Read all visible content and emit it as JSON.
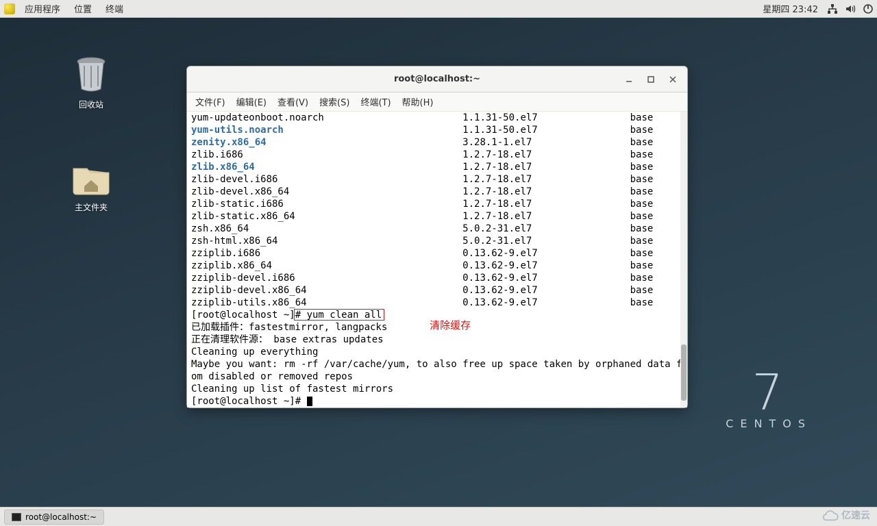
{
  "panel": {
    "apps": "应用程序",
    "places": "位置",
    "terminal": "终端",
    "clock": "星期四 23:42"
  },
  "desktop": {
    "trash_label": "回收站",
    "home_label": "主文件夹"
  },
  "brand": {
    "seven": "7",
    "centos": "CENTOS"
  },
  "taskbar": {
    "task1": "root@localhost:~"
  },
  "watermark": "亿速云",
  "window": {
    "title": "root@localhost:~",
    "menus": [
      "文件(F)",
      "编辑(E)",
      "查看(V)",
      "搜索(S)",
      "终端(T)",
      "帮助(H)"
    ]
  },
  "annotation": {
    "clear_cache": "清除缓存"
  },
  "packages": [
    {
      "name": "yum-updateonboot.noarch",
      "version": "1.1.31-50.el7",
      "repo": "base",
      "hl": false
    },
    {
      "name": "yum-utils.noarch",
      "version": "1.1.31-50.el7",
      "repo": "base",
      "hl": true
    },
    {
      "name": "zenity.x86_64",
      "version": "3.28.1-1.el7",
      "repo": "base",
      "hl": true
    },
    {
      "name": "zlib.i686",
      "version": "1.2.7-18.el7",
      "repo": "base",
      "hl": false
    },
    {
      "name": "zlib.x86_64",
      "version": "1.2.7-18.el7",
      "repo": "base",
      "hl": true
    },
    {
      "name": "zlib-devel.i686",
      "version": "1.2.7-18.el7",
      "repo": "base",
      "hl": false
    },
    {
      "name": "zlib-devel.x86_64",
      "version": "1.2.7-18.el7",
      "repo": "base",
      "hl": false
    },
    {
      "name": "zlib-static.i686",
      "version": "1.2.7-18.el7",
      "repo": "base",
      "hl": false
    },
    {
      "name": "zlib-static.x86_64",
      "version": "1.2.7-18.el7",
      "repo": "base",
      "hl": false
    },
    {
      "name": "zsh.x86_64",
      "version": "5.0.2-31.el7",
      "repo": "base",
      "hl": false
    },
    {
      "name": "zsh-html.x86_64",
      "version": "5.0.2-31.el7",
      "repo": "base",
      "hl": false
    },
    {
      "name": "zziplib.i686",
      "version": "0.13.62-9.el7",
      "repo": "base",
      "hl": false
    },
    {
      "name": "zziplib.x86_64",
      "version": "0.13.62-9.el7",
      "repo": "base",
      "hl": false
    },
    {
      "name": "zziplib-devel.i686",
      "version": "0.13.62-9.el7",
      "repo": "base",
      "hl": false
    },
    {
      "name": "zziplib-devel.x86_64",
      "version": "0.13.62-9.el7",
      "repo": "base",
      "hl": false
    },
    {
      "name": "zziplib-utils.x86_64",
      "version": "0.13.62-9.el7",
      "repo": "base",
      "hl": false
    }
  ],
  "terminal_lines": {
    "prompt1_pre": "[root@localhost ~]",
    "prompt1_cmd": "# yum clean all",
    "l1": "已加载插件：fastestmirror, langpacks",
    "l2": "正在清理软件源： base extras updates",
    "l3": "Cleaning up everything",
    "l4": "Maybe you want: rm -rf /var/cache/yum, to also free up space taken by orphaned data from disabled or removed repos",
    "l5": "Cleaning up list of fastest mirrors",
    "prompt2": "[root@localhost ~]# "
  }
}
